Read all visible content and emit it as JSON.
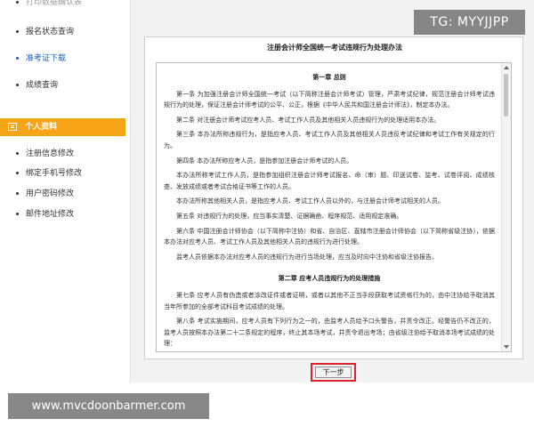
{
  "sidebar": {
    "partial_item": "打印数据确认表",
    "items_top": [
      {
        "label": "报名状态查询"
      },
      {
        "label": "准考证下载"
      },
      {
        "label": "成绩查询"
      }
    ],
    "section": {
      "label": "个人资料",
      "icon": "id-card-icon"
    },
    "items_bottom": [
      {
        "label": "注册信息修改"
      },
      {
        "label": "绑定手机号修改"
      },
      {
        "label": "用户密码修改"
      },
      {
        "label": "邮件地址修改"
      }
    ]
  },
  "document": {
    "title": "注册会计师全国统一考试违规行为处理办法",
    "chapter1": "第一章 总则",
    "paragraphs1": [
      "第一条 为加强注册会计师全国统一考试（以下简称注册会计师考试）管理，严肃考试纪律，规范注册会计师考试违规行为的处理，保证注册会计师考试的公平、公正，根据《中华人民共和国注册会计师法》，制定本办法。",
      "第二条 对注册会计师考试应考人员、考试工作人员及其他相关人员违规行为的处理适用本办法。",
      "第三条 本办法所称违规行为，是指应考人员、考试工作人员及其他相关人员违反考试纪律和考试工作有关规定的行为。",
      "第四条 本办法所称应考人员，是指参加注册会计师考试的人员。",
      "本办法所称考试工作人员，是指参加组织注册会计师考试报名、命（审）题、印送试卷、监考、试卷评阅、成绩核查、发放成绩或者考试合格证书等工作的人员。",
      "本办法所称其他相关人员，是指应考人员、考试工作人员以外的，与注册会计师考试相关的人员。",
      "第五条 对违规行为的处理，应当事实清楚、证据确凿、程序规范、适用规定准确。",
      "第六条 中国注册会计师协会（以下简称中注协）和省、自治区、直辖市注册会计师协会（以下简称省级注协），依据本办法对应考人员、考试工作人员及其他相关人员的违规行为进行处理。",
      "监考人员依据本办法对应考人员的违规行为进行当场处理，应当及时向中注协和省级注协报告。"
    ],
    "chapter2": "第二章 应考人员违规行为的处理措施",
    "paragraphs2": [
      "第七条 应考人员有伪造或者涂改证件或者证明，或者以其他不正当手段获取考试资格行为的，由中注协给予取消其当年所参加的全部考试科目考试成绩的处理。",
      "第八条 考试实施期间，应考人员有下列行为之一的，由监考人员给予口头警告，并责令改正。经警告仍不改正的，监考人员按照本办法第二十二条规定的程序，终止其本场考试，并责令退出考场；由省级注协给予取消本场考试成绩的处理："
    ]
  },
  "next_button": {
    "label": "下一步"
  },
  "watermarks": {
    "top_right": "TG: MYYJJPP",
    "bottom_left": "www.mvcdoonbarmer.com"
  },
  "colors": {
    "accent": "#f7a417",
    "active_link": "#1f61b0",
    "highlight_border": "#d9232e"
  }
}
